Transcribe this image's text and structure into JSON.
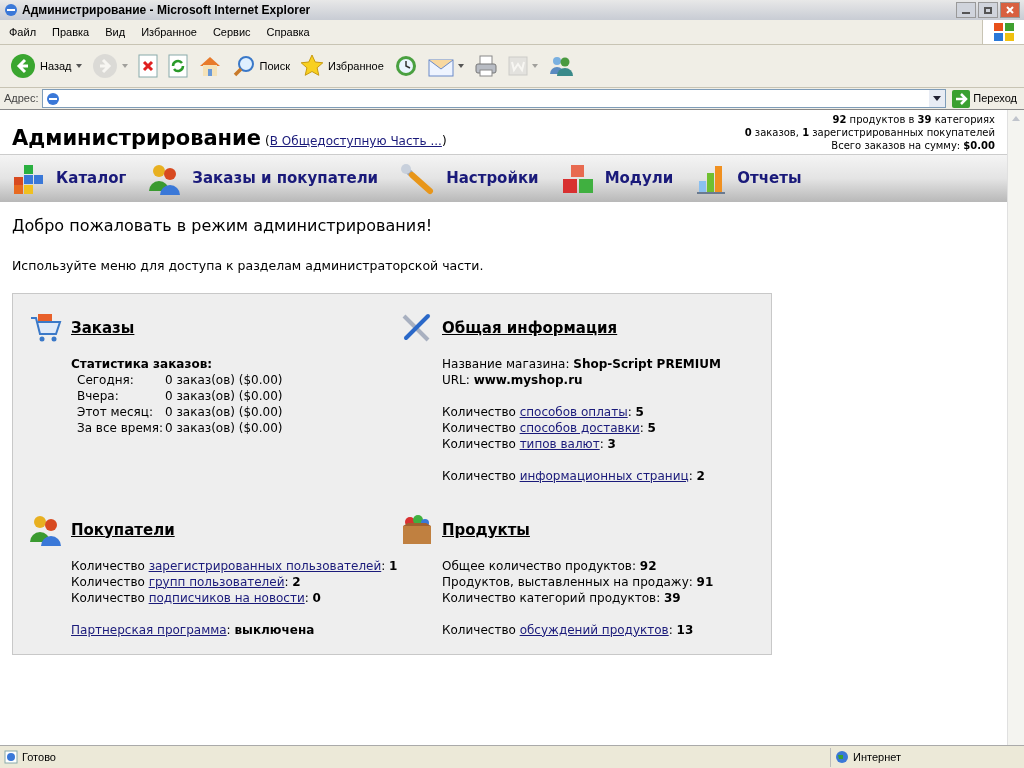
{
  "window": {
    "title": "Администрирование - Microsoft Internet Explorer"
  },
  "menu": [
    "Файл",
    "Правка",
    "Вид",
    "Избранное",
    "Сервис",
    "Справка"
  ],
  "toolbar": [
    {
      "kind": "back",
      "label": "Назад",
      "dropdown": true,
      "disabled": false
    },
    {
      "kind": "forward",
      "dropdown": true,
      "disabled": true
    },
    {
      "kind": "stop",
      "dropdown": false,
      "disabled": false
    },
    {
      "kind": "refresh",
      "dropdown": false,
      "disabled": false
    },
    {
      "kind": "home",
      "dropdown": false,
      "disabled": false
    },
    {
      "kind": "search",
      "label": "Поиск",
      "dropdown": false,
      "disabled": false
    },
    {
      "kind": "favorites",
      "label": "Избранное",
      "dropdown": false,
      "disabled": false
    },
    {
      "kind": "history",
      "dropdown": false,
      "disabled": false
    },
    {
      "kind": "mail",
      "dropdown": true,
      "disabled": false
    },
    {
      "kind": "print",
      "dropdown": false,
      "disabled": false
    },
    {
      "kind": "edit",
      "dropdown": true,
      "disabled": true
    },
    {
      "kind": "messenger",
      "dropdown": false,
      "disabled": false
    }
  ],
  "address_bar": {
    "label": "Адрес:",
    "go": "Переход"
  },
  "page": {
    "title": "Администрирование",
    "public_link": {
      "open": "(",
      "text": "В Общедоступную Часть ...",
      "close": ")"
    },
    "stats": [
      "**92** продуктов в **39** категориях",
      "**0** заказов, **1** зарегистрированных покупателей",
      "Всего заказов на сумму: **$0.00**"
    ],
    "nav": [
      {
        "kind": "catalog",
        "label": "Каталог"
      },
      {
        "kind": "orders",
        "label": "Заказы и покупатели"
      },
      {
        "kind": "settings",
        "label": "Настройки"
      },
      {
        "kind": "modules",
        "label": "Модули"
      },
      {
        "kind": "reports",
        "label": "Отчеты"
      }
    ],
    "welcome": "Добро пожаловать в режим администрирования!",
    "intro": "Используйте меню для доступа к разделам администраторской части.",
    "sections": [
      {
        "kind": "orders",
        "title": "Заказы",
        "stats_title": "Статистика заказов:",
        "stats": [
          {
            "label": "Сегодня:",
            "value": "0 заказ(ов) ($0.00)"
          },
          {
            "label": "Вчера:",
            "value": "0 заказ(ов) ($0.00)"
          },
          {
            "label": "Этот месяц:",
            "value": "0 заказ(ов) ($0.00)"
          },
          {
            "label": "За все время:",
            "value": "0 заказ(ов) ($0.00)"
          }
        ]
      },
      {
        "kind": "info",
        "title": "Общая информация",
        "groups": [
          [
            {
              "label": "Название магазина: ",
              "value": "Shop-Script PREMIUM"
            },
            {
              "label": "URL: ",
              "value": "www.myshop.ru"
            }
          ],
          [
            {
              "label": "Количество ",
              "link": "способов оплаты",
              "after": ": ",
              "value": "5"
            },
            {
              "label": "Количество ",
              "link": "способов доставки",
              "after": ": ",
              "value": "5"
            },
            {
              "label": "Количество ",
              "link": "типов валют",
              "after": ": ",
              "value": "3"
            }
          ],
          [
            {
              "label": "Количество ",
              "link": "информационных страниц",
              "after": ": ",
              "value": "2"
            }
          ]
        ]
      },
      {
        "kind": "customers",
        "title": "Покупатели",
        "groups": [
          [
            {
              "label": "Количество ",
              "link": "зарегистрированных пользователей",
              "after": ": ",
              "value": "1"
            },
            {
              "label": "Количество ",
              "link": "групп пользователей",
              "after": ": ",
              "value": "2"
            },
            {
              "label": "Количество ",
              "link": "подписчиков на новости",
              "after": ": ",
              "value": "0"
            }
          ],
          [
            {
              "link": "Партнерская программа",
              "after": ": ",
              "value": "выключена"
            }
          ]
        ]
      },
      {
        "kind": "products",
        "title": "Продукты",
        "groups": [
          [
            {
              "label": "Общее количество продуктов: ",
              "value": "92"
            },
            {
              "label": "Продуктов, выставленных на продажу: ",
              "value": "91"
            },
            {
              "label": "Количество категорий продуктов: ",
              "value": "39"
            }
          ],
          [
            {
              "label": "Количество ",
              "link": "обсуждений продуктов",
              "after": ": ",
              "value": "13"
            }
          ]
        ]
      }
    ]
  },
  "status_bar": {
    "text": "Готово",
    "zone": "Интернет"
  }
}
